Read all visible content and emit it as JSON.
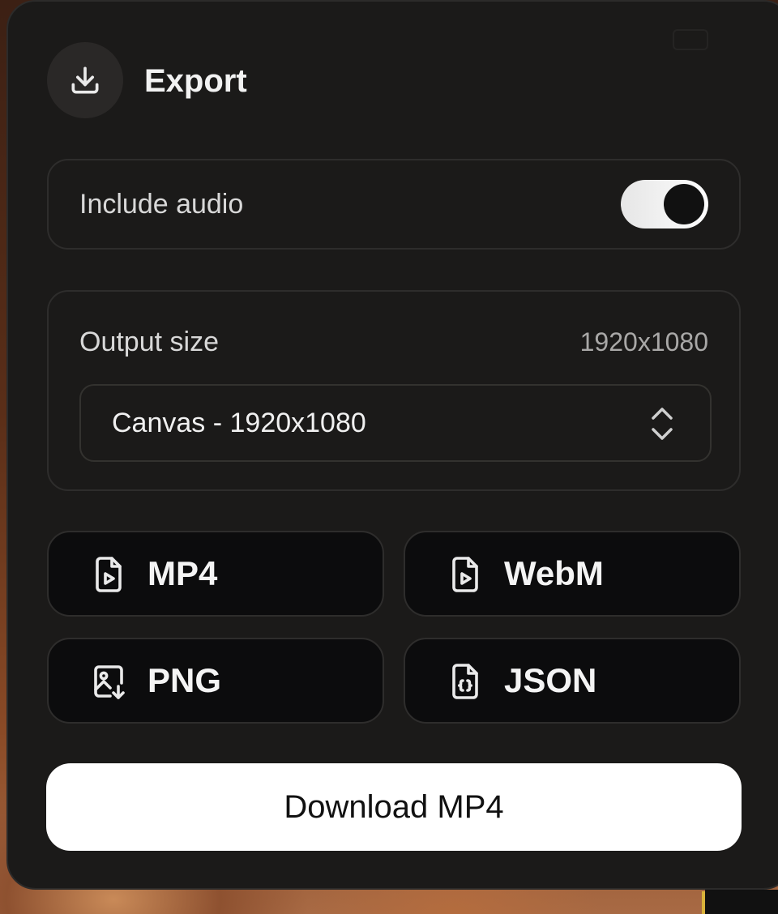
{
  "header": {
    "title": "Export",
    "icon": "download-icon"
  },
  "audio": {
    "label": "Include audio",
    "enabled": true
  },
  "output_size": {
    "label": "Output size",
    "value": "1920x1080",
    "select_value": "Canvas - 1920x1080"
  },
  "formats": [
    {
      "label": "MP4",
      "icon": "video-file-icon"
    },
    {
      "label": "WebM",
      "icon": "video-file-icon"
    },
    {
      "label": "PNG",
      "icon": "image-file-icon"
    },
    {
      "label": "JSON",
      "icon": "code-file-icon"
    }
  ],
  "download": {
    "label": "Download MP4"
  },
  "colors": {
    "panel": "#1b1a19",
    "button_bg": "#0c0c0d",
    "primary": "#ffffff",
    "text": "#f2f2f2",
    "muted": "#a9a8a7"
  }
}
